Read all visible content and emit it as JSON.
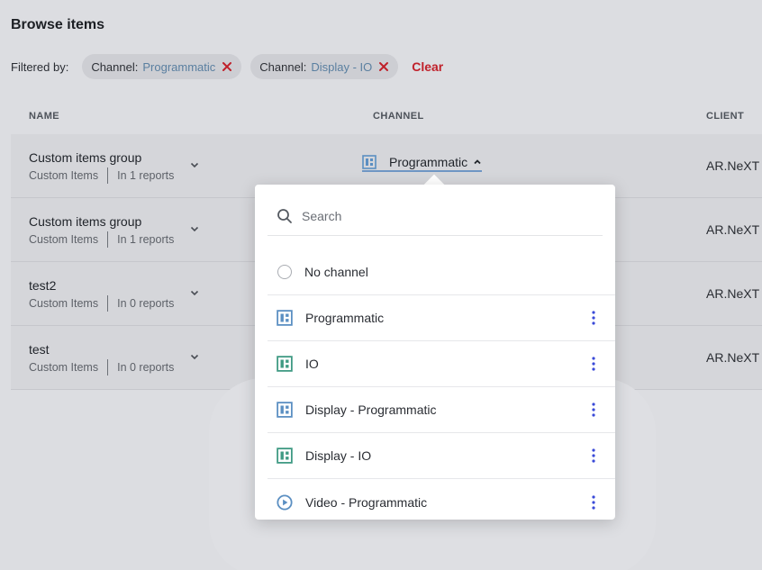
{
  "page": {
    "title": "Browse items"
  },
  "filters": {
    "label": "Filtered by:",
    "chips": [
      {
        "key": "Channel:",
        "value": "Programmatic"
      },
      {
        "key": "Channel:",
        "value": "Display - IO"
      }
    ],
    "clear_label": "Clear"
  },
  "table": {
    "headers": {
      "name": "NAME",
      "channel": "CHANNEL",
      "client": "CLIENT"
    },
    "rows": [
      {
        "name": "Custom items group",
        "type": "Custom Items",
        "reports": "In 1 reports",
        "client": "AR.NeXT"
      },
      {
        "name": "Custom items group",
        "type": "Custom Items",
        "reports": "In 1 reports",
        "client": "AR.NeXT"
      },
      {
        "name": "test2",
        "type": "Custom Items",
        "reports": "In 0 reports",
        "client": "AR.NeXT"
      },
      {
        "name": "test",
        "type": "Custom Items",
        "reports": "In 0 reports",
        "client": "AR.NeXT"
      }
    ]
  },
  "channel_picker": {
    "selected_label": "Programmatic",
    "search_placeholder": "Search",
    "options": [
      {
        "label": "No channel",
        "icon": "radio"
      },
      {
        "label": "Programmatic",
        "icon": "layout-grid-icon"
      },
      {
        "label": "IO",
        "icon": "layout-grid-icon"
      },
      {
        "label": "Display - Programmatic",
        "icon": "layout-grid-icon"
      },
      {
        "label": "Display - IO",
        "icon": "layout-grid-icon"
      },
      {
        "label": "Video - Programmatic",
        "icon": "play-circle-icon"
      }
    ]
  },
  "colors": {
    "accent_red": "#c0202a",
    "chip_value_blue": "#5a7fa0",
    "icon_blue": "#5b8fc2",
    "icon_green": "#3f9a83",
    "kebab_blue": "#3a4ad8"
  }
}
